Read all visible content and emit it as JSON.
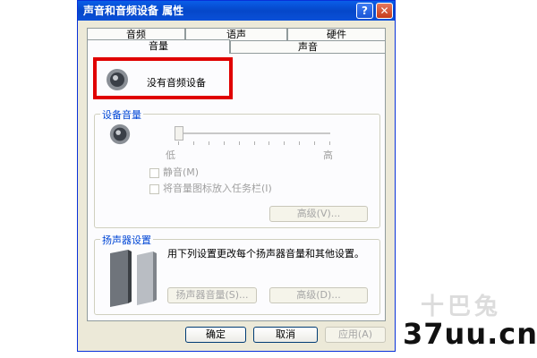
{
  "window": {
    "title": "声音和音频设备 属性",
    "help_label": "?",
    "close_label": "✕"
  },
  "tabs": {
    "row1": [
      {
        "label": "音频"
      },
      {
        "label": "语声"
      },
      {
        "label": "硬件"
      }
    ],
    "row2": [
      {
        "label": "音量",
        "active": true
      },
      {
        "label": "声音"
      }
    ]
  },
  "device": {
    "status_text": "没有音频设备",
    "icon": "speaker-icon"
  },
  "device_volume": {
    "group_title": "设备音量",
    "low_label": "低",
    "high_label": "高",
    "slider_level": 0,
    "mute_label": "静音(M)",
    "taskbar_label": "将音量图标放入任务栏(I)",
    "advanced_button": "高级(V)..."
  },
  "speaker_settings": {
    "group_title": "扬声器设置",
    "description": "用下列设置更改每个扬声器音量和其他设置。",
    "speaker_volume_button": "扬声器音量(S)...",
    "advanced_button": "高级(D)..."
  },
  "footer": {
    "ok_button": "确定",
    "cancel_button": "取消",
    "apply_button": "应用(A)"
  },
  "watermark": {
    "text": "37uu.cn",
    "faint_text": "十巴兔"
  },
  "colors": {
    "titlebar": "#0a5ee8",
    "highlight_box": "#e00000",
    "group_title": "#0046d5",
    "window_bg": "#ece9d8"
  }
}
